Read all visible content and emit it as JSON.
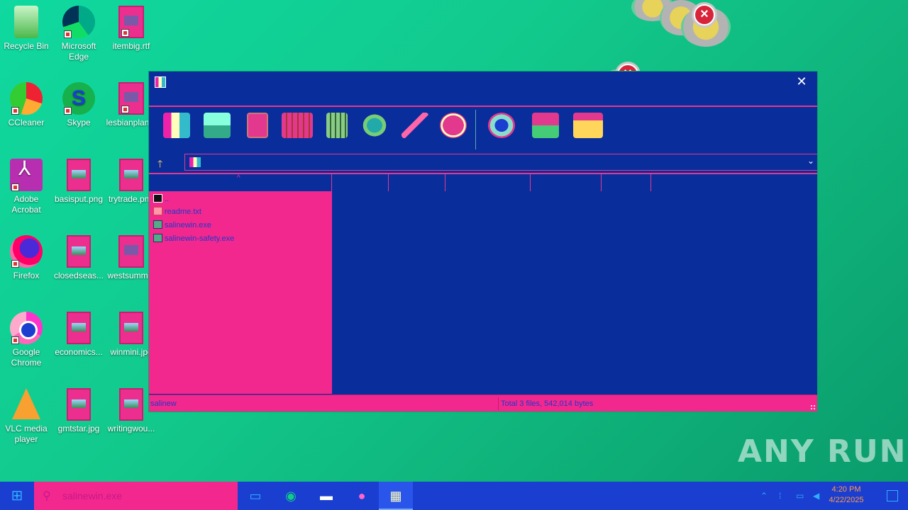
{
  "desktop": {
    "icons": [
      {
        "label": "Recycle Bin"
      },
      {
        "label": "Microsoft Edge"
      },
      {
        "label": "itembig.rtf"
      },
      {
        "label": "CCleaner"
      },
      {
        "label": "Skype"
      },
      {
        "label": "lesbianplan..."
      },
      {
        "label": "Adobe Acrobat"
      },
      {
        "label": "basisput.png"
      },
      {
        "label": "trytrade.png"
      },
      {
        "label": "Firefox"
      },
      {
        "label": "closedseas..."
      },
      {
        "label": "westsumm..."
      },
      {
        "label": "Google Chrome"
      },
      {
        "label": "economics..."
      },
      {
        "label": "winmini.jpg"
      },
      {
        "label": "VLC media player"
      },
      {
        "label": "gmtstar.jpg"
      },
      {
        "label": "writingwou..."
      }
    ]
  },
  "window": {
    "files": [
      {
        "name": ".."
      },
      {
        "name": "readme.txt"
      },
      {
        "name": "salinewin.exe"
      },
      {
        "name": "salinewin-safety.exe"
      }
    ],
    "status": {
      "left": "salinew",
      "right": "Total 3 files, 542,014 bytes"
    }
  },
  "taskbar": {
    "search_text": "salinewin.exe",
    "clock_time": "4:20 PM",
    "clock_date": "4/22/2025"
  },
  "watermark": "ANY RUN",
  "colors": {
    "window_bg": "#0a2d9c",
    "pane_pink": "#f2288f",
    "taskbar": "#1a3ed0"
  }
}
